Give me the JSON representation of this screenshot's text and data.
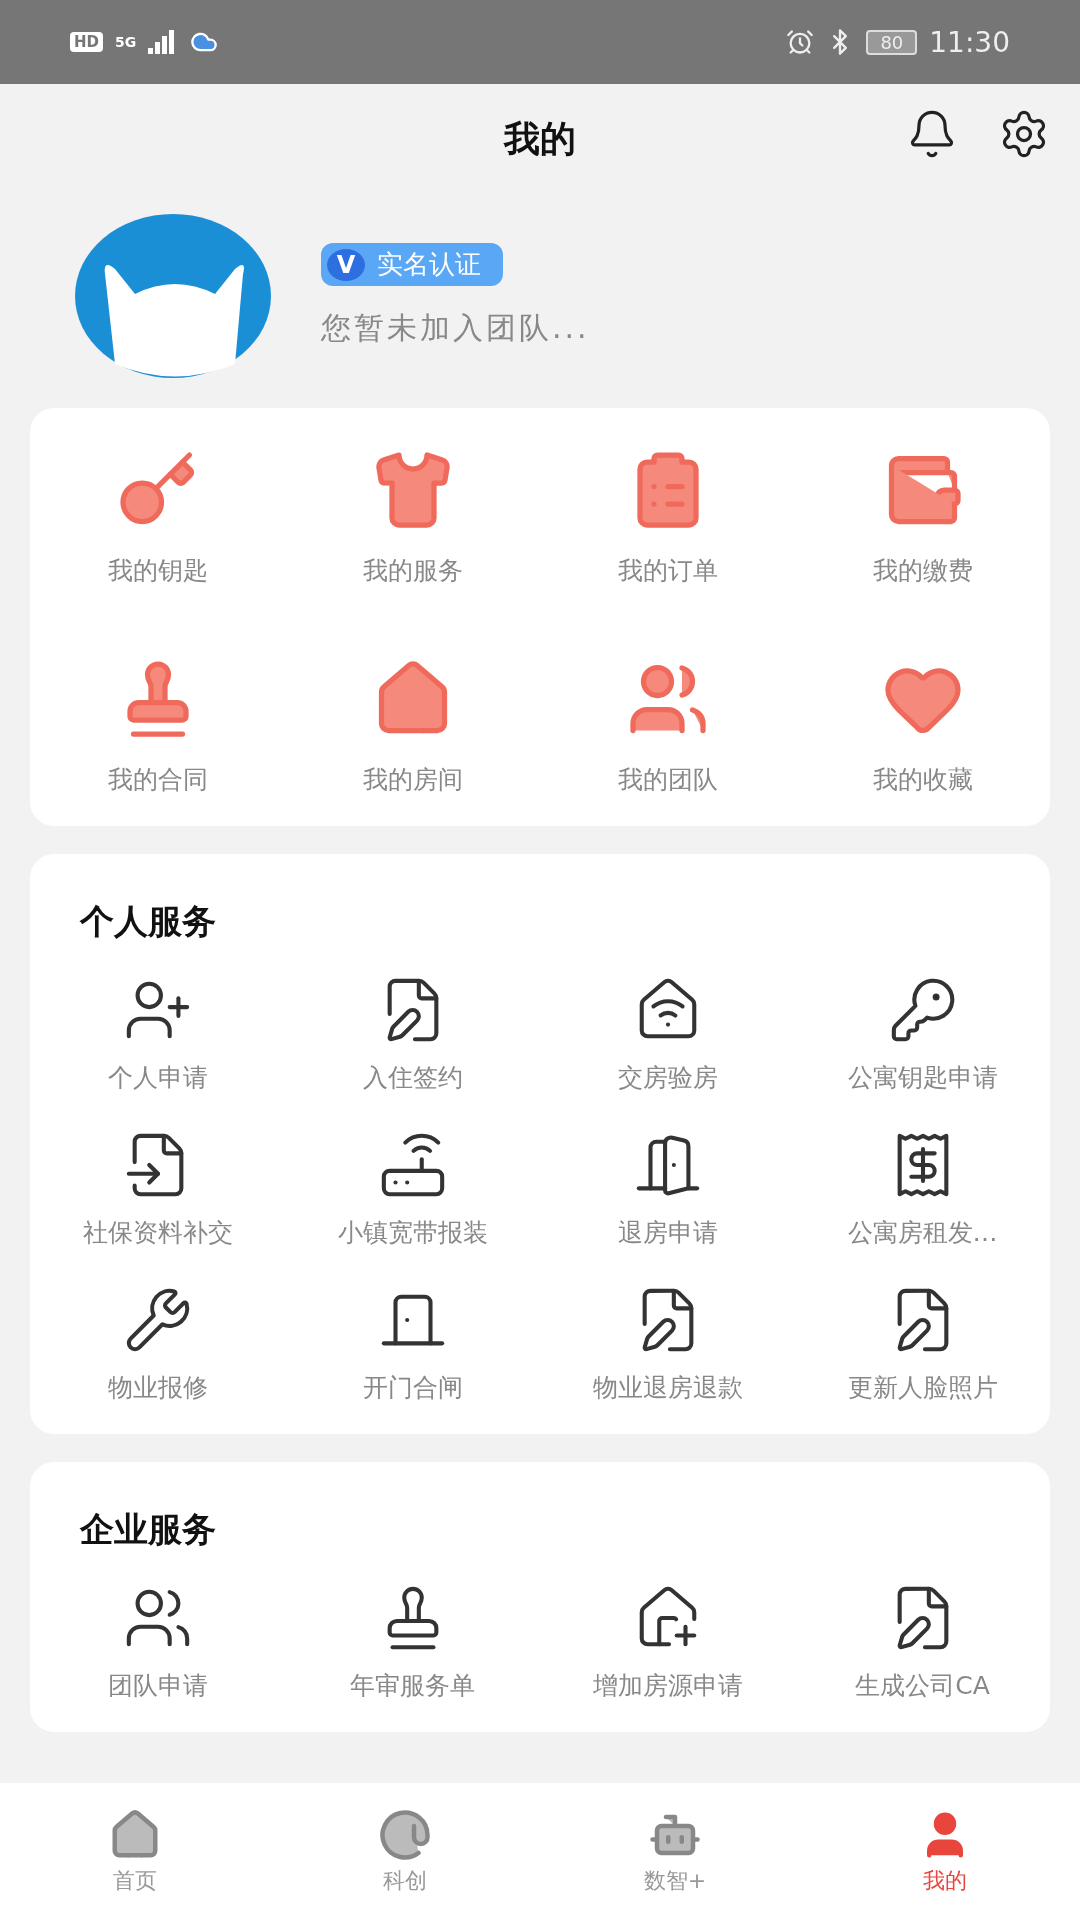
{
  "status_bar": {
    "hd": "HD",
    "network": "5G",
    "battery": "80",
    "time": "11:30"
  },
  "header": {
    "title": "我的"
  },
  "profile": {
    "badge": "实名认证",
    "badge_mark": "V",
    "subtitle": "您暂未加入团队..."
  },
  "quick_menu": [
    {
      "label": "我的钥匙"
    },
    {
      "label": "我的服务"
    },
    {
      "label": "我的订单"
    },
    {
      "label": "我的缴费"
    },
    {
      "label": "我的合同"
    },
    {
      "label": "我的房间"
    },
    {
      "label": "我的团队"
    },
    {
      "label": "我的收藏"
    }
  ],
  "sections": [
    {
      "title": "个人服务",
      "items": [
        {
          "label": "个人申请"
        },
        {
          "label": "入住签约"
        },
        {
          "label": "交房验房"
        },
        {
          "label": "公寓钥匙申请"
        },
        {
          "label": "社保资料补交"
        },
        {
          "label": "小镇宽带报装"
        },
        {
          "label": "退房申请"
        },
        {
          "label": "公寓房租发…"
        },
        {
          "label": "物业报修"
        },
        {
          "label": "开门合闸"
        },
        {
          "label": "物业退房退款"
        },
        {
          "label": "更新人脸照片"
        }
      ]
    },
    {
      "title": "企业服务",
      "items": [
        {
          "label": "团队申请"
        },
        {
          "label": "年审服务单"
        },
        {
          "label": "增加房源申请"
        },
        {
          "label": "生成公司CA"
        }
      ]
    }
  ],
  "bottom_nav": [
    {
      "label": "首页",
      "selected": false
    },
    {
      "label": "科创",
      "selected": false
    },
    {
      "label": "数智+",
      "selected": false
    },
    {
      "label": "我的",
      "selected": true
    }
  ]
}
